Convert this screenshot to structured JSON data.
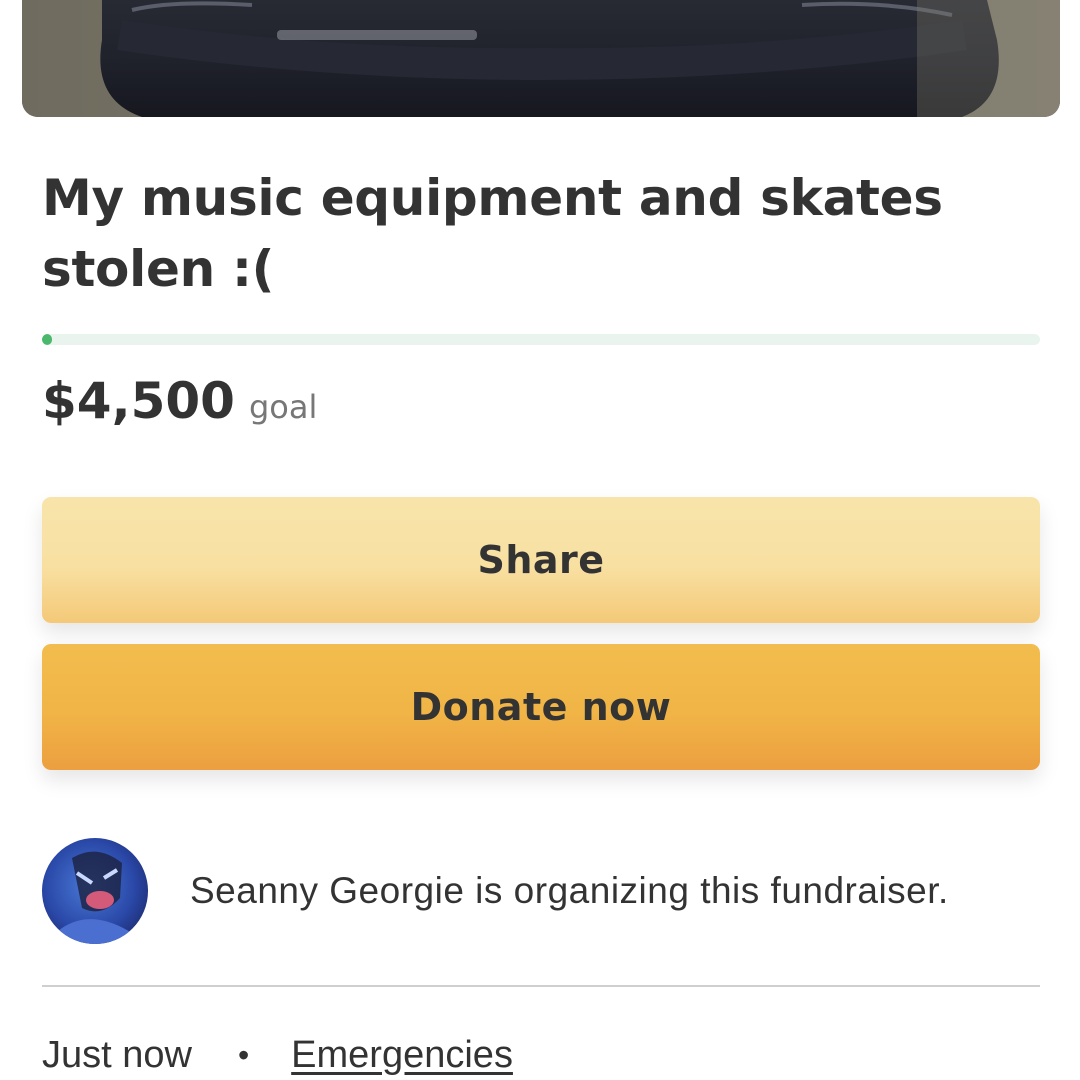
{
  "fundraiser": {
    "title": "My music equipment and skates stolen :(",
    "goal_amount": "$4,500",
    "goal_label": "goal",
    "progress_fraction": 0.01
  },
  "actions": {
    "share_label": "Share",
    "donate_label": "Donate now"
  },
  "organizer": {
    "text": "Seanny Georgie is organizing this fundraiser."
  },
  "meta": {
    "posted": "Just now",
    "separator": "•",
    "category": "Emergencies"
  },
  "colors": {
    "progress_fill": "#4cb86b",
    "progress_track": "#eaf4ee",
    "share_button": "#f8e0a2",
    "donate_button": "#f1b446",
    "text": "#333333"
  }
}
